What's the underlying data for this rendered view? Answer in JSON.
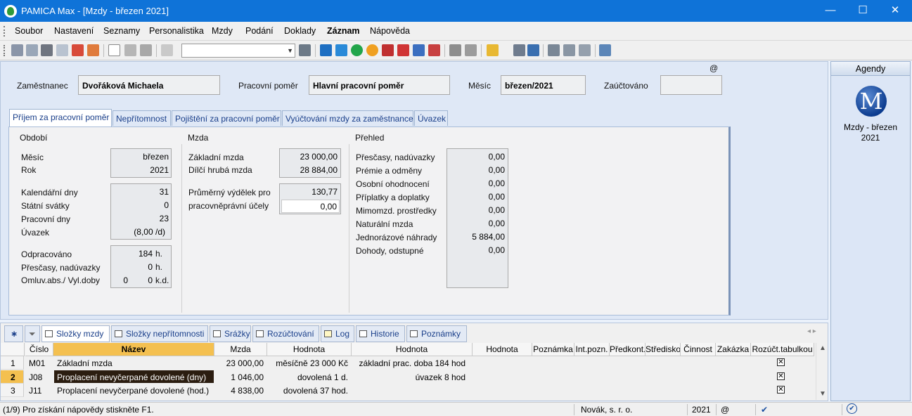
{
  "window": {
    "title": "PAMICA Max - [Mzdy - březen 2021]",
    "min": "—",
    "max": "☐",
    "close": "✕"
  },
  "menu": [
    "Soubor",
    "Nastavení",
    "Seznamy",
    "Personalistika",
    "Mzdy",
    "Podání",
    "Doklady",
    "Záznam",
    "Nápověda"
  ],
  "header": {
    "employee_label": "Zaměstnanec",
    "employee_value": "Dvořáková Michaela",
    "relation_label": "Pracovní poměr",
    "relation_value": "Hlavní pracovní poměr",
    "month_label": "Měsíc",
    "month_value": "březen/2021",
    "posted_label": "Zaúčtováno",
    "posted_value": "",
    "at_sign": "@"
  },
  "tabs": [
    "Příjem za pracovní poměr",
    "Nepřítomnost",
    "Pojištění za pracovní poměr",
    "Vyúčtování mzdy za zaměstnance",
    "Úvazek"
  ],
  "period": {
    "title": "Období",
    "month_label": "Měsíc",
    "month_value": "březen",
    "year_label": "Rok",
    "year_value": "2021",
    "calendar_days_label": "Kalendářní dny",
    "calendar_days": "31",
    "holidays_label": "Státní svátky",
    "holidays": "0",
    "work_days_label": "Pracovní dny",
    "work_days": "23",
    "load_label": "Úvazek",
    "load_value": "(8,00 /d)",
    "worked_label": "Odpracováno",
    "worked_value": "184",
    "worked_unit": "h.",
    "overtime_label": "Přesčasy, nadúvazky",
    "overtime_value": "0",
    "overtime_unit": "h.",
    "absence_label": "Omluv.abs./ Vyl.doby",
    "absence_a": "0",
    "absence_b": "0",
    "absence_unit": "k.d."
  },
  "wage": {
    "title": "Mzda",
    "base_label": "Základní mzda",
    "base_value": "23 000,00",
    "gross_label": "Dílčí hrubá mzda",
    "gross_value": "28 884,00",
    "avg_label_1": "Průměrný výdělek pro",
    "avg_label_2": "pracovněprávní účely",
    "avg_value": "130,77",
    "avg_input": "0,00"
  },
  "overview": {
    "title": "Přehled",
    "rows": [
      {
        "label": "Přesčasy, nadúvazky",
        "value": "0,00"
      },
      {
        "label": "Prémie a odměny",
        "value": "0,00"
      },
      {
        "label": "Osobní ohodnocení",
        "value": "0,00"
      },
      {
        "label": "Příplatky a doplatky",
        "value": "0,00"
      },
      {
        "label": "Mimomzd. prostředky",
        "value": "0,00"
      },
      {
        "label": "Naturální mzda",
        "value": "0,00"
      },
      {
        "label": "Jednorázové náhrady",
        "value": "5 884,00"
      },
      {
        "label": "Dohody, odstupné",
        "value": "0,00"
      }
    ]
  },
  "bottom_tabs": [
    "Složky mzdy",
    "Složky nepřítomnosti",
    "Srážky",
    "Rozúčtování",
    "Log",
    "Historie",
    "Poznámky"
  ],
  "grid": {
    "columns": [
      "Číslo",
      "Název",
      "Mzda",
      "Hodnota",
      "Hodnota",
      "Hodnota",
      "Poznámka",
      "Int.pozn.",
      "Předkont.",
      "Středisko",
      "Činnost",
      "Zakázka",
      "Rozúčt.tabulkou"
    ],
    "rows": [
      {
        "n": "1",
        "code": "M01",
        "name": "Základní mzda",
        "wage": "23 000,00",
        "v1": "měsíčně 23 000 Kč",
        "v2": "základní prac. doba 184 hod",
        "checked": "✕"
      },
      {
        "n": "2",
        "code": "J08",
        "name": "Proplacení nevyčerpané dovolené (dny)",
        "wage": "1 046,00",
        "v1": "dovolená 1 d.",
        "v2": "úvazek 8 hod",
        "checked": "✕"
      },
      {
        "n": "3",
        "code": "J11",
        "name": "Proplacení nevyčerpané dovolené (hod.)",
        "wage": "4 838,00",
        "v1": "dovolená 37 hod.",
        "v2": "",
        "checked": "✕"
      }
    ]
  },
  "agenda": {
    "header": "Agendy",
    "label_1": "Mzdy - březen",
    "label_2": "2021",
    "logo": "M"
  },
  "status": {
    "hint": "(1/9) Pro získání nápovědy stiskněte F1.",
    "company": "Novák, s. r. o.",
    "year": "2021",
    "at": "@"
  }
}
